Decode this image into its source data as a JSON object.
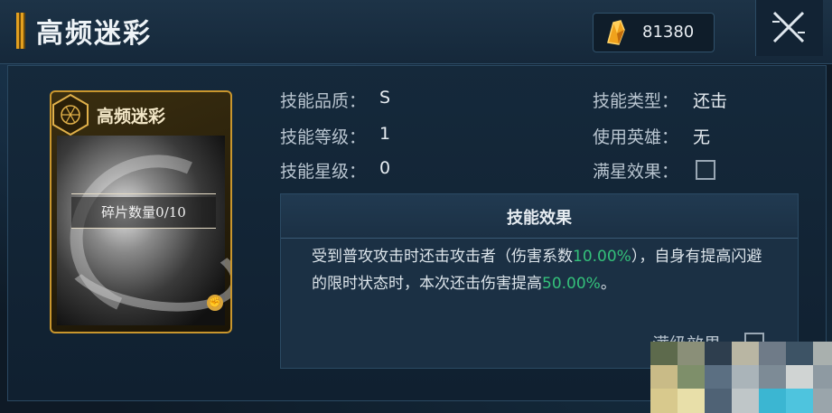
{
  "header": {
    "title": "高频迷彩",
    "currency_icon": "gold-crystal-icon",
    "currency_value": "81380",
    "close_icon": "close-icon"
  },
  "card": {
    "badge_icon": "hexagon-emblem-icon",
    "title": "高频迷彩",
    "fragment_text": "碎片数量0/10",
    "fist_icon": "fist-icon"
  },
  "info": {
    "quality_label": "技能品质：",
    "quality_value": "S",
    "level_label": "技能等级：",
    "level_value": "1",
    "star_label": "技能星级：",
    "star_value": "0",
    "type_label": "技能类型：",
    "type_value": "还击",
    "hero_label": "使用英雄：",
    "hero_value": "无",
    "fullstar_label": "满星效果："
  },
  "effect": {
    "title": "技能效果",
    "text_part1": "受到普攻攻击时还击攻击者（伤害系数",
    "pct1": "10.00%",
    "text_part2": "），自身有提高闪避的限时状态时，本次还击伤害提高",
    "pct2": "50.00%",
    "text_part3": "。"
  },
  "max_level_label": "满级效果",
  "colors": {
    "accent_gold": "#c9962d",
    "highlight_green": "#34c07a"
  }
}
